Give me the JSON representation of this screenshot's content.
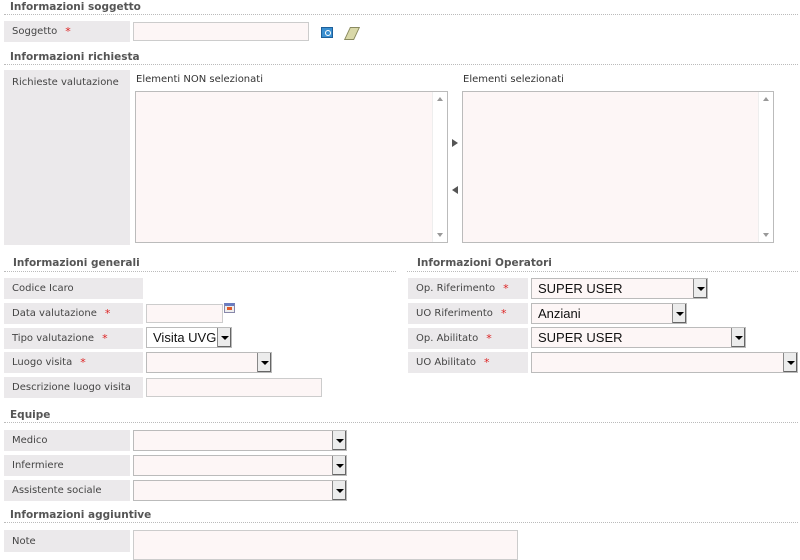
{
  "sections": {
    "soggetto": "Informazioni soggetto",
    "richiesta": "Informazioni richiesta",
    "generali": "Informazioni generali",
    "operatori": "Informazioni Operatori",
    "equipe": "Equipe",
    "aggiuntive": "Informazioni aggiuntive"
  },
  "soggetto": {
    "label": "Soggetto",
    "required": "*"
  },
  "richiesta": {
    "label": "Richieste valutazione",
    "non_selected_title": "Elementi NON selezionati",
    "selected_title": "Elementi selezionati"
  },
  "generali": {
    "codice_icaro": "Codice Icaro",
    "data_valutazione": "Data valutazione",
    "tipo_valutazione": "Tipo valutazione",
    "tipo_value": "Visita UVG",
    "luogo_visita": "Luogo visita",
    "descrizione_luogo": "Descrizione luogo visita",
    "required": "*"
  },
  "operatori": {
    "op_rif": "Op. Riferimento",
    "op_rif_value": "SUPER USER",
    "uo_rif": "UO Riferimento",
    "uo_rif_value": "Anziani",
    "op_abil": "Op. Abilitato",
    "op_abil_value": "SUPER USER",
    "uo_abil": "UO Abilitato",
    "required": "*"
  },
  "equipe": {
    "medico": "Medico",
    "infermiere": "Infermiere",
    "assistente": "Assistente sociale"
  },
  "aggiuntive": {
    "note": "Note"
  }
}
